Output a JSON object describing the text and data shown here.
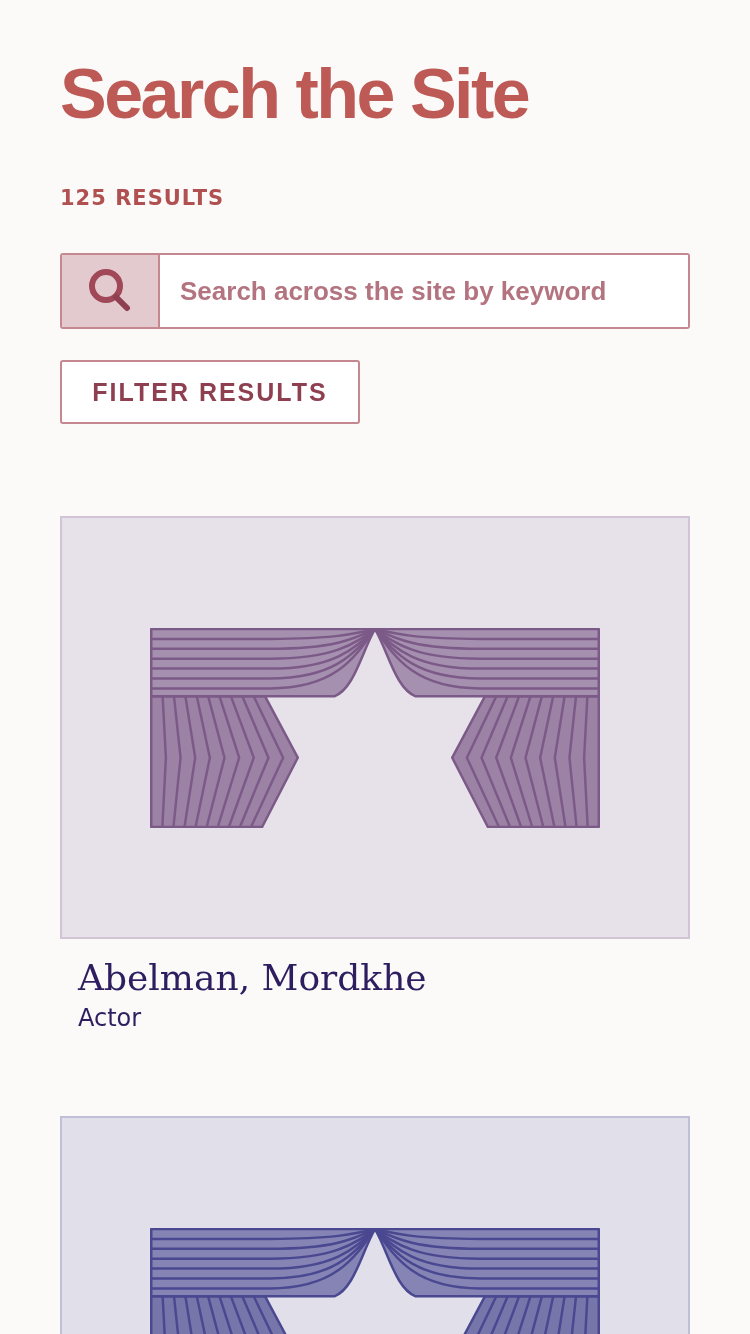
{
  "page": {
    "title": "Search the Site",
    "result_count": "125 RESULTS"
  },
  "search": {
    "placeholder": "Search across the site by keyword"
  },
  "filter_button": {
    "label": "FILTER RESULTS"
  },
  "results": [
    {
      "title": "Abelman, Mordkhe",
      "subtitle": "Actor",
      "color": "#7c5a88"
    },
    {
      "color": "#4a4890"
    }
  ]
}
